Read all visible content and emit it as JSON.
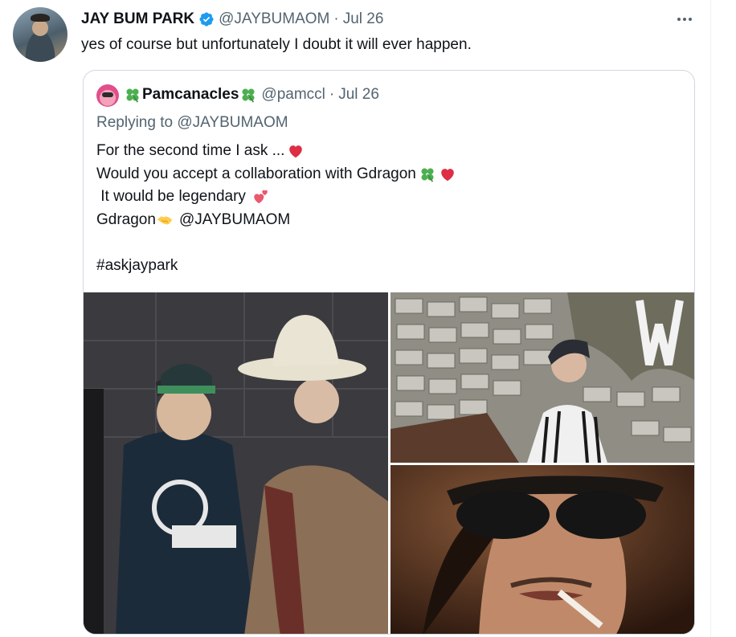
{
  "tweet": {
    "display_name": "JAY BUM PARK",
    "handle": "@JAYBUMAOM",
    "separator": "·",
    "date": "Jul 26",
    "text": "yes of course but unfortunately I doubt it will ever happen.",
    "icons": {
      "verified": "verified-badge-icon",
      "more": "more-options-icon"
    },
    "colors": {
      "verified": "#1d9bf0",
      "secondary_text": "#536471",
      "primary_text": "#0f1419",
      "border": "#cfd9de"
    }
  },
  "quoted": {
    "display_name": "Pamcanacles",
    "handle": "@pamccl",
    "separator": "·",
    "date": "Jul 26",
    "replying_prefix": "Replying to ",
    "replying_to": "@JAYBUMAOM",
    "lines": [
      "For the second time I ask ...",
      "Would you accept a collaboration with Gdragon ",
      " It would be legendary ",
      "Gdragon ",
      "#askjaypark"
    ],
    "line4_mention": "@JAYBUMAOM",
    "emoji": [
      "four-leaf-clover",
      "red-heart",
      "heart-exclamation",
      "handshake"
    ],
    "media_count": 3
  }
}
